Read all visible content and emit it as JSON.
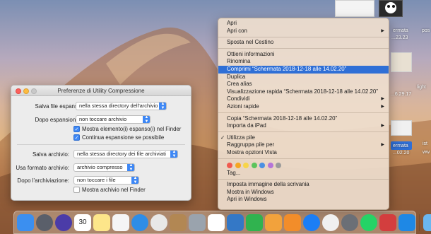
{
  "prefs_window": {
    "title": "Preferenze di Utility Compressione",
    "expand_save_label": "Salva file espansi:",
    "expand_save_value": "nella stessa directory dell'archivio",
    "after_expand_label": "Dopo espansione:",
    "after_expand_value": "non toccare archivio",
    "show_expanded_label": "Mostra elemento(i) espanso(i) nel Finder",
    "show_expanded_checked": true,
    "continue_expand_label": "Continua espansione se possibile",
    "continue_expand_checked": true,
    "archive_save_label": "Salva archivio:",
    "archive_save_value": "nella stessa directory dei file archiviati",
    "format_label": "Usa formato archivio:",
    "format_value": "archivio compresso",
    "after_archive_label": "Dopo l'archiviazione:",
    "after_archive_value": "non toccare i file",
    "show_archive_label": "Mostra archivio nel Finder",
    "show_archive_checked": false
  },
  "context_menu": {
    "open": "Apri",
    "open_with": "Apri con",
    "move_to_trash": "Sposta nel Cestino",
    "get_info": "Ottieni informazioni",
    "rename": "Rinomina",
    "compress": "Comprimi “Schermata 2018-12-18 alle 14.02.20”",
    "duplicate": "Duplica",
    "make_alias": "Crea alias",
    "quick_look": "Visualizzazione rapida “Schermata 2018-12-18 alle 14.02.20”",
    "share": "Condividi",
    "quick_actions": "Azioni rapide",
    "copy": "Copia “Schermata 2018-12-18 alle 14.02.20”",
    "import_ipad": "Importa da iPad",
    "use_stacks": "Utilizza pile",
    "group_stacks_by": "Raggruppa pile per",
    "show_view_options": "Mostra opzioni Vista",
    "tags": "Tag...",
    "set_desktop_picture": "Imposta immagine della scrivania",
    "show_in_windows": "Mostra in Windows",
    "open_in_windows": "Apri in Windows",
    "tag_colors": [
      "#f05a4f",
      "#f5a623",
      "#f7d54a",
      "#5cc45c",
      "#4a90e2",
      "#b574d8",
      "#9b9b9b"
    ]
  },
  "desktop_labels": {
    "label_a": "ermata",
    "label_a2": "...23.23",
    "label_b": "...6.29.17",
    "label_c": "ermata",
    "label_c2": "...02.20",
    "label_d": "light",
    "label_e": "ist",
    "label_e2": "ww",
    "label_f": "pos"
  },
  "dock": {
    "items": [
      {
        "name": "finder-icon",
        "color": "#3b8ff0"
      },
      {
        "name": "launchpad-icon",
        "color": "#5a5f6a"
      },
      {
        "name": "siri-icon",
        "color": "#4b3ca8"
      },
      {
        "name": "calendar-icon",
        "color": "#ffffff",
        "text": "30"
      },
      {
        "name": "notes-icon",
        "color": "#fde68a"
      },
      {
        "name": "reminders-icon",
        "color": "#f5f5f5"
      },
      {
        "name": "safari-icon",
        "color": "#2e8de6"
      },
      {
        "name": "chrome-icon",
        "color": "#e8e8e8"
      },
      {
        "name": "archive-icon",
        "color": "#b28753"
      },
      {
        "name": "mail-icon",
        "color": "#9aa3ad"
      },
      {
        "name": "photos-icon",
        "color": "#ffffff"
      },
      {
        "name": "keynote-icon",
        "color": "#3478c6"
      },
      {
        "name": "numbers-icon",
        "color": "#30b34f"
      },
      {
        "name": "slideshow-icon",
        "color": "#f2a23c"
      },
      {
        "name": "books-icon",
        "color": "#f28d2a"
      },
      {
        "name": "appstore-icon",
        "color": "#1c7ef5"
      },
      {
        "name": "music-icon",
        "color": "#f0f0f0"
      },
      {
        "name": "settings-icon",
        "color": "#6b6f76"
      },
      {
        "name": "whatsapp-icon",
        "color": "#25d366"
      },
      {
        "name": "parallels-icon",
        "color": "#d33e3e"
      },
      {
        "name": "windows-icon",
        "color": "#1e88e5"
      },
      {
        "name": "downloads-icon",
        "color": "#6bb7f0"
      },
      {
        "name": "trash-icon",
        "color": "#d8dde3"
      }
    ]
  }
}
